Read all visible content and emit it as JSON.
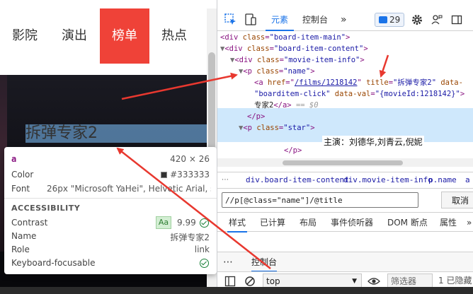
{
  "page": {
    "nav": [
      "影院",
      "演出",
      "榜单",
      "热点"
    ],
    "movie_title": "拆弹专家2"
  },
  "tooltip": {
    "tag": "a",
    "size": "420 × 26",
    "color_label": "Color",
    "color_value": "#333333",
    "font_label": "Font",
    "font_value": "26px \"Microsoft YaHei\", Helvetic  Arial, s...",
    "accessibility_heading": "ACCESSIBILITY",
    "contrast_label": "Contrast",
    "contrast_badge": "Aa",
    "contrast_value": "9.99",
    "name_label": "Name",
    "name_value": "拆弹专家2",
    "role_label": "Role",
    "role_value": "link",
    "focus_label": "Keyboard-focusable"
  },
  "devtools": {
    "tabs": {
      "elements": "元素",
      "console": "控制台",
      "more": "»",
      "message_count": "29"
    },
    "dom": {
      "line1_tag": "<div",
      "line1_attr": "class",
      "line1_val": "\"board-item-main\"",
      "line2_tag": "<div",
      "line2_attr": "class",
      "line2_val": "\"board-item-content\"",
      "line3_tag": "<div",
      "line3_attr": "class",
      "line3_val": "\"movie-item-info\"",
      "line4_tag": "<p",
      "line4_attr": "class",
      "line4_val": "\"name\"",
      "line5_tag": "<a",
      "line5_href_attr": "href",
      "line5_href_val": "/films/1218142",
      "line5_title_attr": "title",
      "line5_title_val": "\"拆弹专家2\"",
      "line5_data_attr": "data-",
      "line6_val": "\"boarditem-click\"",
      "line6_attr": "data-val",
      "line6_val2": "\"{movieId:1218142}\"",
      "line7_text": "专家2",
      "line7_close": "</a>",
      "line7_eq": "== $0",
      "line8": "</p>",
      "line9_tag": "<p",
      "line9_attr": "class",
      "line9_val": "\"star\"",
      "line10": "</p>",
      "actors_overlay": "主演：刘德华,刘青云,倪妮"
    },
    "breadcrumbs": [
      "div.board-item-content",
      "div.movie-item-info",
      "p.name",
      "a"
    ],
    "xpath_query": "//p[@class=\"name\"]/@title",
    "cancel_label": "取消",
    "style_tabs": [
      "样式",
      "已计算",
      "布局",
      "事件侦听器",
      "DOM 断点",
      "属性",
      "»"
    ],
    "drawer": {
      "more": "⋯",
      "console_tab": "控制台",
      "context": "top",
      "filter_placeholder": "筛选器",
      "hidden": "1 已隐藏"
    }
  },
  "colors": {
    "nav_active": "#ef4238",
    "highlight": "#6fa8dc",
    "arrow": "#e8382f",
    "selected_row": "#cfe8fc",
    "accent": "#1a73e8"
  }
}
